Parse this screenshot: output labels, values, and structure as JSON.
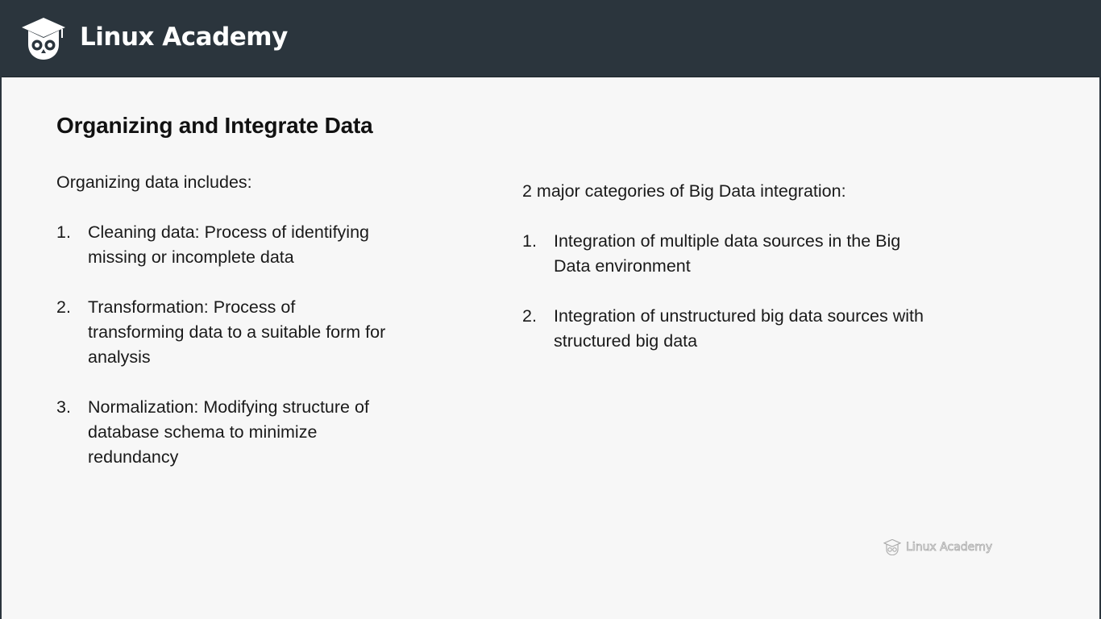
{
  "header": {
    "brand_name": "Linux Academy",
    "brand_icon": "owl-graduation-cap-icon",
    "background_color": "#2b353d"
  },
  "slide": {
    "title": "Organizing and Integrate Data",
    "left_column": {
      "intro": "Organizing data includes:",
      "items": [
        {
          "number": "1.",
          "text": "Cleaning data: Process of identifying missing or incomplete data"
        },
        {
          "number": "2.",
          "text": "Transformation: Process of transforming data to a suitable form for analysis"
        },
        {
          "number": "3.",
          "text": "Normalization: Modifying structure of database schema to minimize redundancy"
        }
      ]
    },
    "right_column": {
      "intro": "2 major categories of Big Data integration:",
      "items": [
        {
          "number": "1.",
          "text": "Integration of multiple data sources in the Big Data environment"
        },
        {
          "number": "2.",
          "text": "Integration of unstructured big data sources with structured big data"
        }
      ]
    }
  },
  "watermark": {
    "text": "Linux Academy",
    "icon": "owl-graduation-cap-icon"
  }
}
